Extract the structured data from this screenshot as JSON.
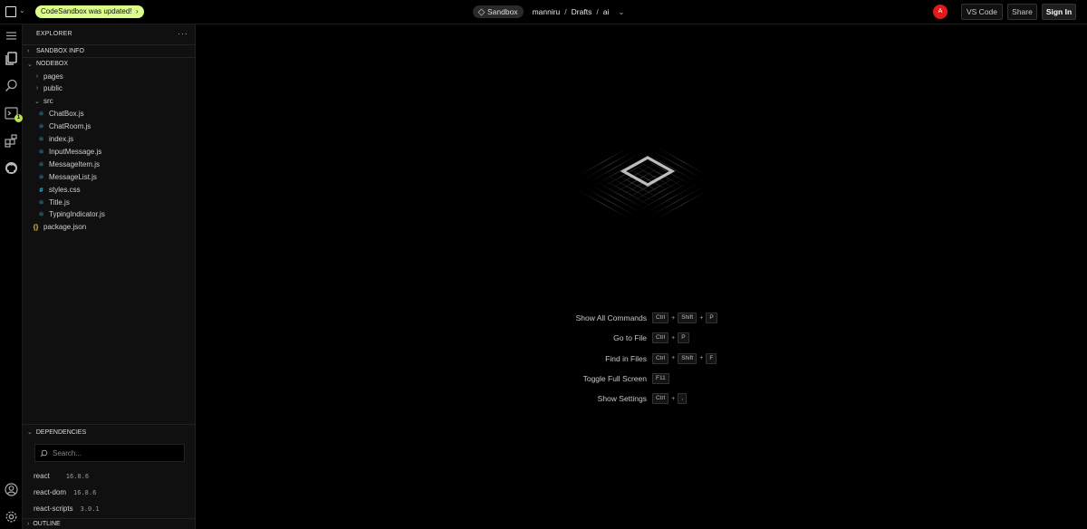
{
  "topbar": {
    "update_text": "CodeSandbox was updated!",
    "sandbox_label": "Sandbox",
    "breadcrumb": [
      "manniru",
      "Drafts",
      "ai"
    ],
    "separator": "/",
    "avatar_initial": "A",
    "vscode_label": "VS Code",
    "share_label": "Share",
    "signin_label": "Sign In"
  },
  "activity": {
    "icons": [
      "menu-icon",
      "files-icon",
      "search-icon",
      "terminal-icon",
      "extensions-icon",
      "github-icon",
      "account-icon",
      "settings-icon"
    ],
    "terminal_badge": "1"
  },
  "sidebar": {
    "title": "EXPLORER",
    "more": "···",
    "sandbox_info": "SANDBOX INFO",
    "nodebox": "NODEBOX",
    "tree": [
      {
        "name": "pages",
        "type": "folder",
        "expanded": false
      },
      {
        "name": "public",
        "type": "folder",
        "expanded": false
      },
      {
        "name": "src",
        "type": "folder",
        "expanded": true
      },
      {
        "name": "ChatBox.js",
        "type": "react"
      },
      {
        "name": "ChatRoom.js",
        "type": "react"
      },
      {
        "name": "index.js",
        "type": "react"
      },
      {
        "name": "InputMessage.js",
        "type": "react"
      },
      {
        "name": "MessageItem.js",
        "type": "react"
      },
      {
        "name": "MessageList.js",
        "type": "react"
      },
      {
        "name": "styles.css",
        "type": "css"
      },
      {
        "name": "Title.js",
        "type": "react"
      },
      {
        "name": "TypingIndicator.js",
        "type": "react"
      },
      {
        "name": "package.json",
        "type": "json"
      }
    ],
    "dependencies": {
      "title": "DEPENDENCIES",
      "search_placeholder": "Search...",
      "items": [
        {
          "name": "react",
          "version": "16.8.6"
        },
        {
          "name": "react-dom",
          "version": "16.8.6"
        },
        {
          "name": "react-scripts",
          "version": "3.0.1"
        }
      ]
    },
    "outline": "OUTLINE"
  },
  "main": {
    "commands": [
      {
        "label": "Show All Commands",
        "keys": [
          "Ctrl",
          "Shift",
          "P"
        ]
      },
      {
        "label": "Go to File",
        "keys": [
          "Ctrl",
          "P"
        ]
      },
      {
        "label": "Find in Files",
        "keys": [
          "Ctrl",
          "Shift",
          "F"
        ]
      },
      {
        "label": "Toggle Full Screen",
        "keys": [
          "F11"
        ]
      },
      {
        "label": "Show Settings",
        "keys": [
          "Ctrl",
          ","
        ]
      }
    ]
  },
  "colors": {
    "accent": "#dcff8a",
    "avatar": "#e21a1a",
    "react_icon": "#4fb6e8",
    "json_icon": "#d6c94e"
  }
}
